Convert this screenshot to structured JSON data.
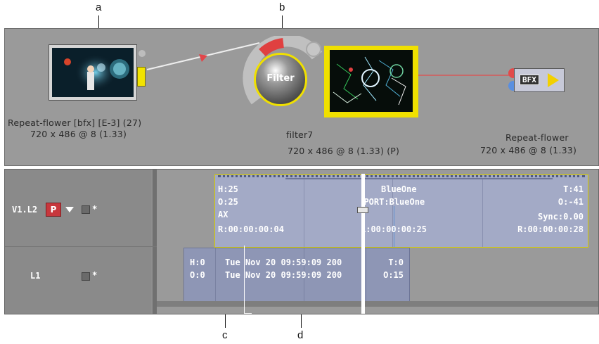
{
  "callouts": {
    "a": "a",
    "b": "b",
    "c": "c",
    "d": "d"
  },
  "nodes": {
    "source": {
      "name": "Repeat-flower [bfx]  [E-3] (27)",
      "dims": "720 x 486 @ 8 (1.33)"
    },
    "filter": {
      "button_label": "Filter",
      "name": "filter7",
      "dims": "720 x 486 @ 8 (1.33) (P)"
    },
    "output": {
      "badge": "BFX",
      "name": "Repeat-flower",
      "dims": "720 x 486 @ 8 (1.33)"
    }
  },
  "tracks": [
    {
      "id": "V1.L2",
      "patch": "P",
      "star": "*"
    },
    {
      "id": "L1",
      "star": "*"
    }
  ],
  "clips": {
    "upper": {
      "head": "H:25",
      "offset": "O:25",
      "mode": "AX",
      "rec": "R:00:00:00:04",
      "title": "BlueOne",
      "import": "IMPORT:BlueOne",
      "length": "L:00:00:00:25",
      "tail": "T:41",
      "tail_offset": "O:-41",
      "sync": "Sync:0.00",
      "rec_out": "R:00:00:00:28"
    },
    "lower": {
      "head": "H:0",
      "offset": "O:0",
      "date1": "Tue Nov 20 09:59:09 200",
      "date2": "Tue Nov 20 09:59:09 200",
      "tail": "T:0",
      "tail_offset": "O:15"
    }
  },
  "colors": {
    "panel": "#9a9a9a",
    "clip_upper": "#a3aac6",
    "clip_lower": "#8e96b5",
    "highlight": "#f0e000",
    "patch": "#c8373d"
  }
}
